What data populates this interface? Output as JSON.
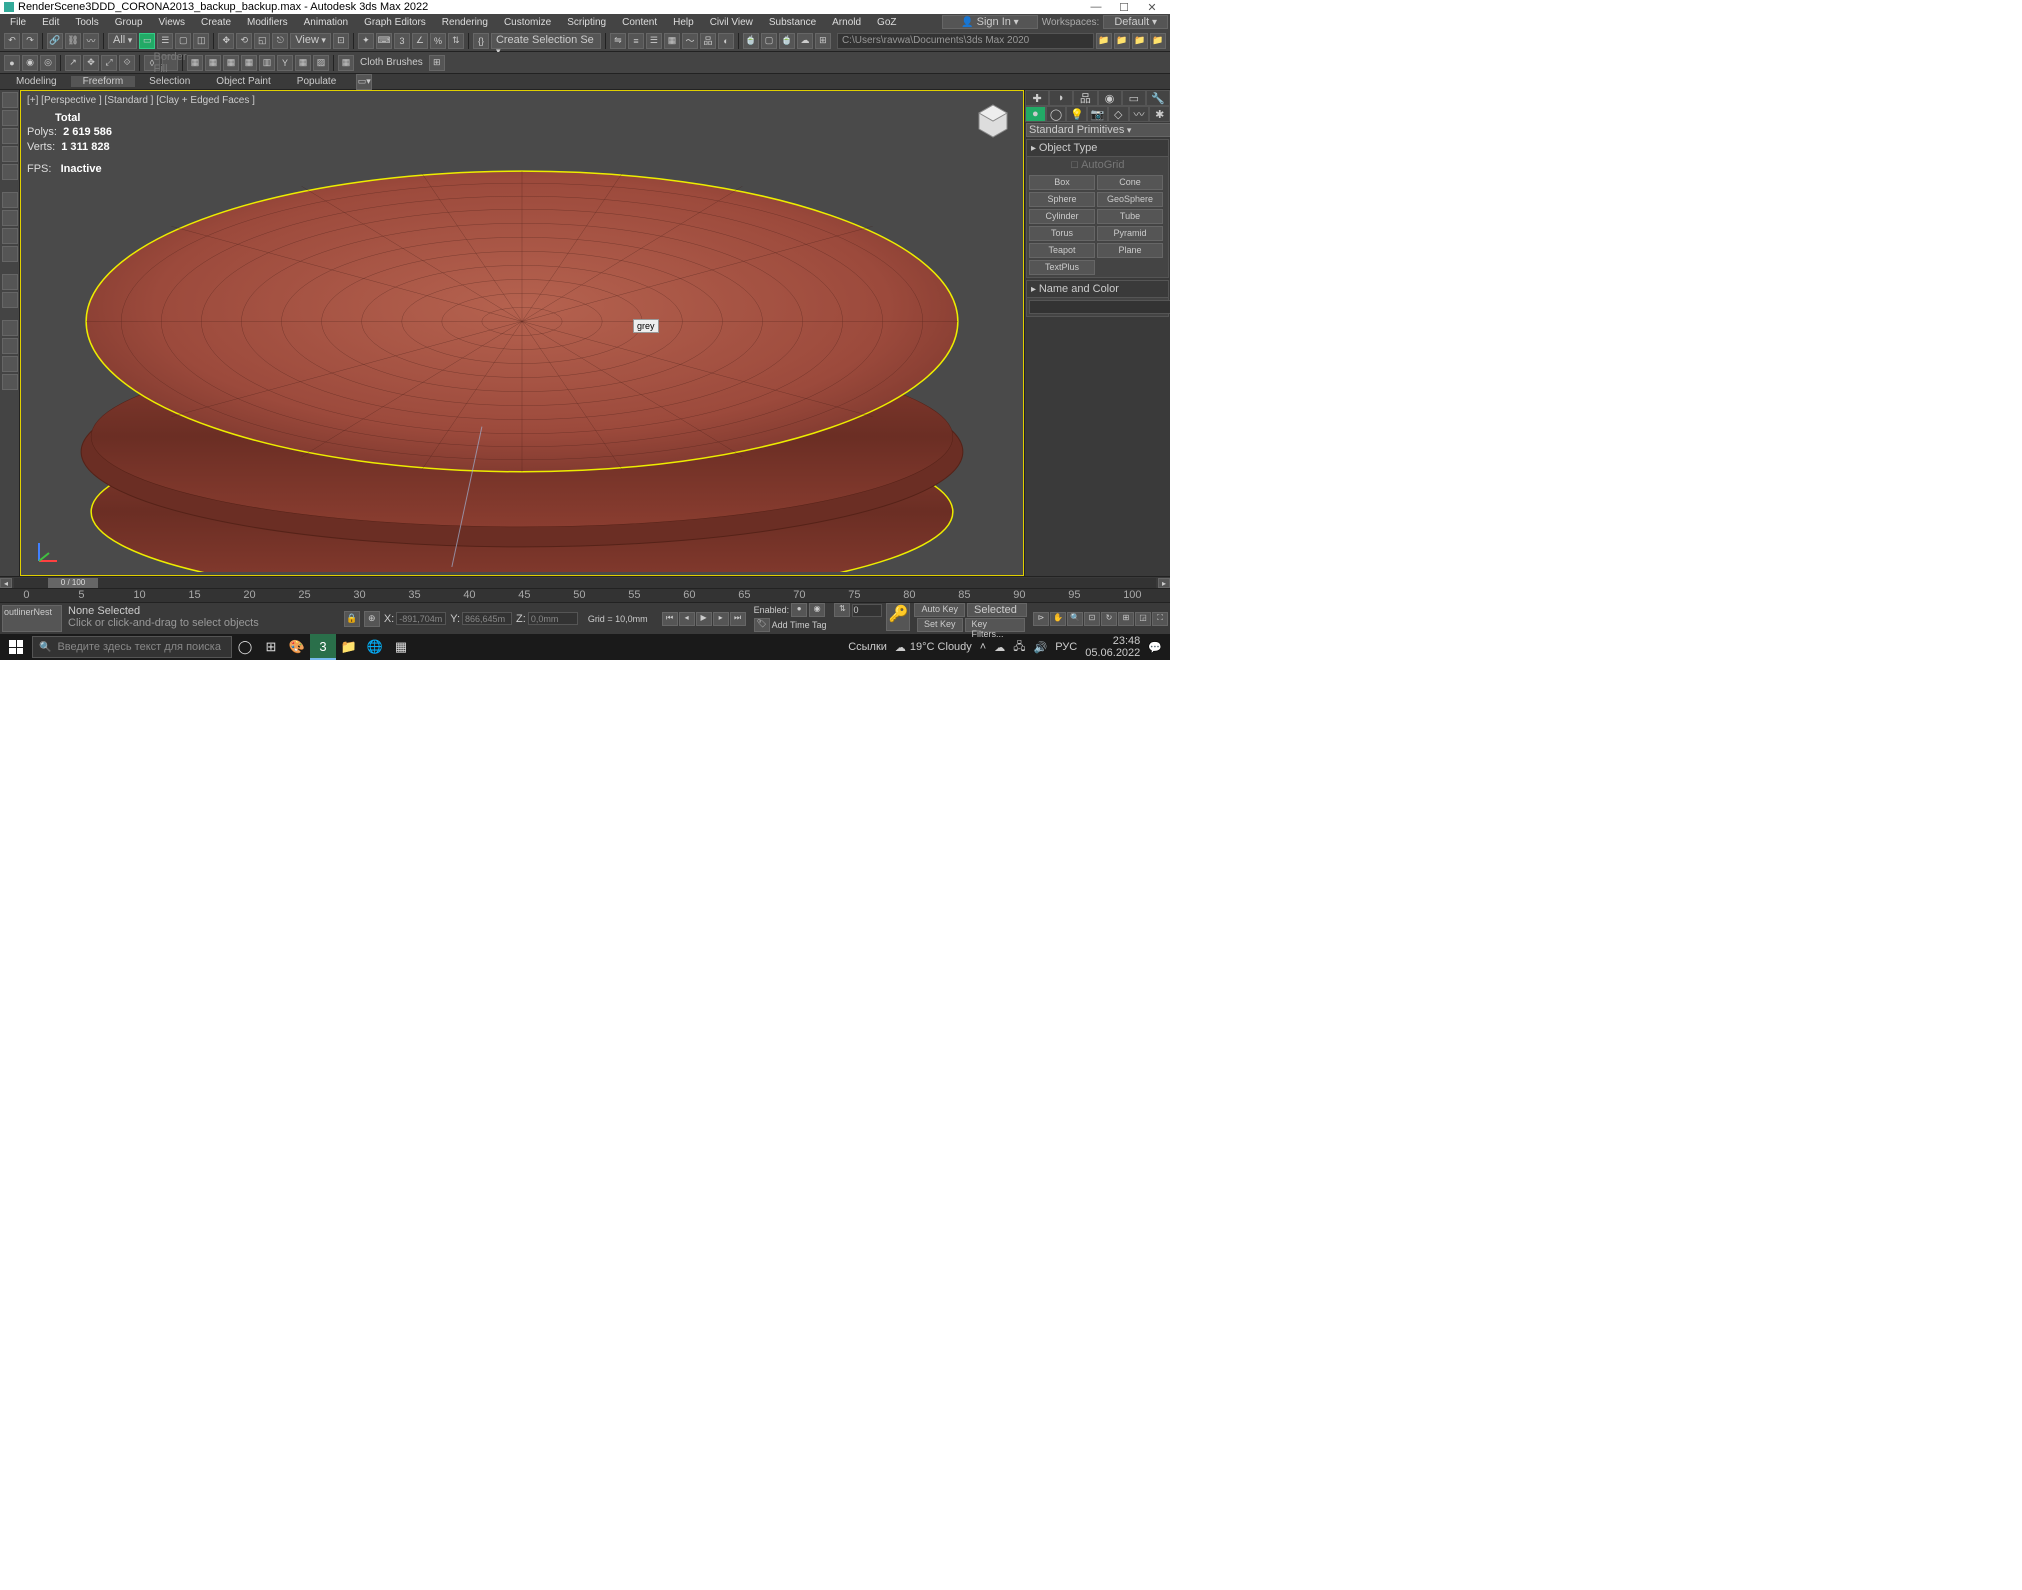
{
  "title": "RenderScene3DDD_CORONA2013_backup_backup.max - Autodesk 3ds Max 2022",
  "menus": [
    "File",
    "Edit",
    "Tools",
    "Group",
    "Views",
    "Create",
    "Modifiers",
    "Animation",
    "Graph Editors",
    "Rendering",
    "Customize",
    "Scripting",
    "Content",
    "Help",
    "Civil View",
    "Substance",
    "Arnold",
    "GoZ"
  ],
  "signin": "Sign In",
  "workspaces_label": "Workspaces:",
  "workspace": "Default",
  "tb_all": "All",
  "tb_view": "View",
  "tb_create_sel": "Create Selection Se",
  "path": "C:\\Users\\ravwa\\Documents\\3ds Max 2020",
  "border_fill": "Border Fill",
  "cloth_brushes": "Cloth Brushes",
  "ribbon_tabs": [
    "Modeling",
    "Freeform",
    "Selection",
    "Object Paint",
    "Populate"
  ],
  "ribbon_active": 1,
  "vp_label": "[+] [Perspective ] [Standard ] [Clay + Edged Faces ]",
  "stats": {
    "total": "Total",
    "polys_label": "Polys:",
    "polys": "2 619 586",
    "verts_label": "Verts:",
    "verts": "1 311 828",
    "fps_label": "FPS:",
    "fps": "Inactive"
  },
  "tooltip": "grey",
  "rp": {
    "std_prim": "Standard Primitives",
    "obj_type": "Object Type",
    "autogrid": "AutoGrid",
    "btns": [
      "Box",
      "Cone",
      "Sphere",
      "GeoSphere",
      "Cylinder",
      "Tube",
      "Torus",
      "Pyramid",
      "Teapot",
      "Plane",
      "TextPlus"
    ],
    "name_color": "Name and Color"
  },
  "timeslider": "0 / 100",
  "ruler_ticks": [
    0,
    5,
    10,
    15,
    20,
    25,
    30,
    35,
    40,
    45,
    50,
    55,
    60,
    65,
    70,
    75,
    80,
    85,
    90,
    95,
    100
  ],
  "status": {
    "outliner": "outlinerNest",
    "none": "None Selected",
    "hint": "Click or click-and-drag to select objects",
    "x": "X:",
    "xv": "-891,704m",
    "y": "Y:",
    "yv": "866,645m",
    "z": "Z:",
    "zv": "0,0mm",
    "grid": "Grid = 10,0mm",
    "enabled": "Enabled:",
    "addtag": "Add Time Tag",
    "autokey": "Auto Key",
    "selected": "Selected",
    "setkey": "Set Key",
    "keyfilters": "Key Filters..."
  },
  "taskbar": {
    "search": "Введите здесь текст для поиска",
    "links": "Ссылки",
    "weather": "19°C  Cloudy",
    "lang": "РУС",
    "time": "23:48",
    "date": "05.06.2022"
  }
}
